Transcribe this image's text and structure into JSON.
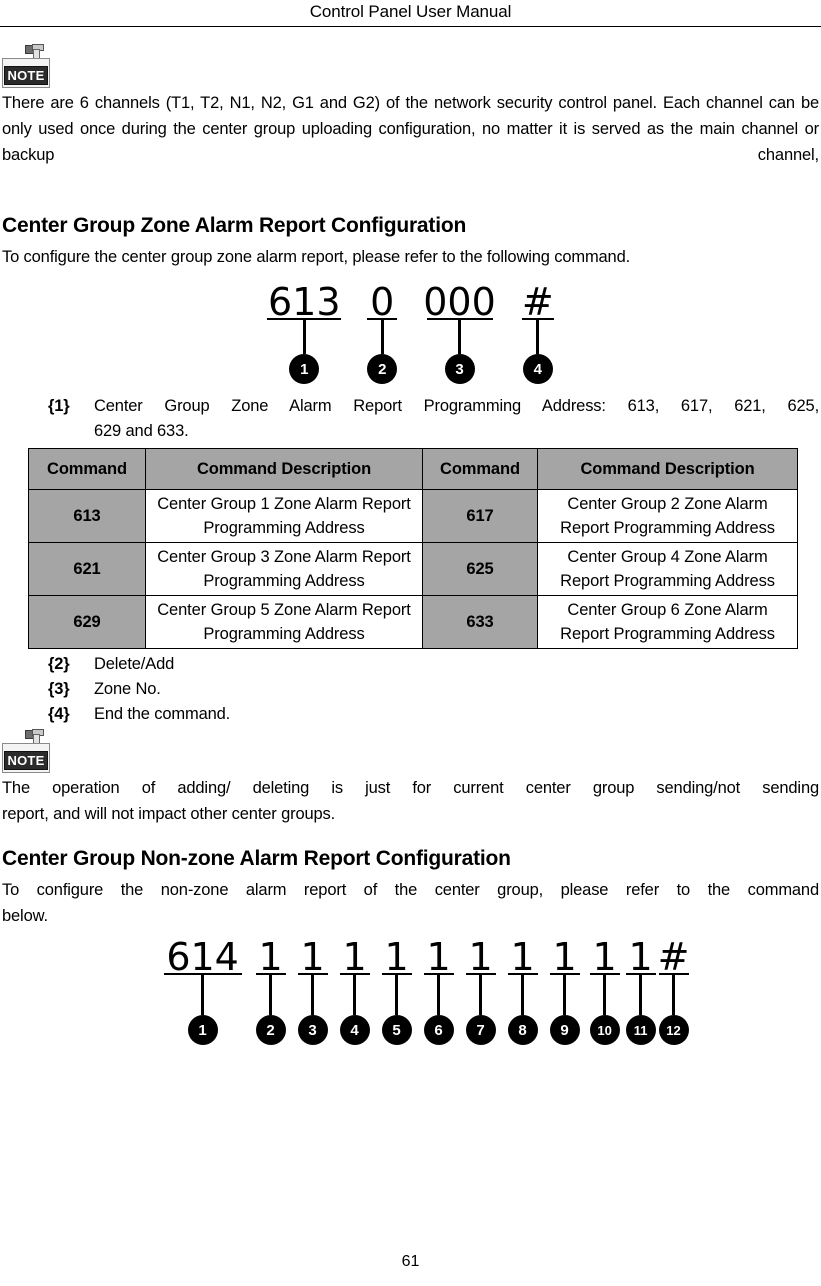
{
  "header": {
    "title": "Control Panel User Manual"
  },
  "note1": {
    "icon_label": "NOTE",
    "text": "There are 6 channels (T1, T2, N1, N2, G1 and G2) of the network security control panel. Each channel can be only used once during the center group uploading configuration, no matter it is served as the main channel or backup channel,",
    "line1": "There are 6 channels (T1, T2, N1, N2, G1 and G2) of the network security control panel.",
    "line2": "Each channel can be only used once during the center group uploading configuration, no",
    "line3": "matter it is served as the main channel or backup channel,"
  },
  "section1": {
    "heading": "Center Group Zone Alarm Report Configuration",
    "intro": "To configure the center group zone alarm report, please refer to the following command.",
    "diagram": {
      "tokens": [
        {
          "glyph": "613",
          "badge": "1"
        },
        {
          "glyph": "0",
          "badge": "2"
        },
        {
          "glyph": "000",
          "badge": "3"
        },
        {
          "glyph": "#",
          "badge": "4"
        }
      ]
    },
    "items": [
      {
        "marker": "{1}",
        "line1": "Center Group Zone Alarm Report Programming Address:   613, 617, 621, 625,",
        "line2": "629 and 633."
      },
      {
        "marker": "{2}",
        "line1": "Delete/Add",
        "line2": ""
      },
      {
        "marker": "{3}",
        "line1": "Zone No.",
        "line2": ""
      },
      {
        "marker": "{4}",
        "line1": "End the command.",
        "line2": ""
      }
    ],
    "table": {
      "headers": [
        "Command",
        "Command Description",
        "Command",
        "Command Description"
      ],
      "rows": [
        {
          "cmd_a": "613",
          "desc_a": "Center Group 1 Zone Alarm Report Programming Address",
          "cmd_b": "617",
          "desc_b": "Center Group 2 Zone Alarm Report Programming Address"
        },
        {
          "cmd_a": "621",
          "desc_a": "Center Group 3 Zone Alarm Report Programming Address",
          "cmd_b": "625",
          "desc_b": "Center Group 4 Zone Alarm Report Programming Address"
        },
        {
          "cmd_a": "629",
          "desc_a": "Center Group 5 Zone Alarm Report Programming Address",
          "cmd_b": "633",
          "desc_b": "Center Group 6 Zone Alarm Report Programming Address"
        }
      ]
    }
  },
  "note2": {
    "icon_label": "NOTE",
    "line1": "The operation of adding/ deleting is just for current center group sending/not sending",
    "line2": "report, and will not impact other center groups."
  },
  "section2": {
    "heading": "Center Group Non-zone Alarm Report Configuration",
    "line1": "To configure the non-zone alarm report of the center group, please refer to the command",
    "line2": "below.",
    "diagram": {
      "tokens": [
        {
          "glyph": "614",
          "badge": "1"
        },
        {
          "glyph": "1",
          "badge": "2"
        },
        {
          "glyph": "1",
          "badge": "3"
        },
        {
          "glyph": "1",
          "badge": "4"
        },
        {
          "glyph": "1",
          "badge": "5"
        },
        {
          "glyph": "1",
          "badge": "6"
        },
        {
          "glyph": "1",
          "badge": "7"
        },
        {
          "glyph": "1",
          "badge": "8"
        },
        {
          "glyph": "1",
          "badge": "9"
        },
        {
          "glyph": "1",
          "badge": "10"
        },
        {
          "glyph": "1",
          "badge": "11"
        },
        {
          "glyph": "#",
          "badge": "12"
        }
      ]
    }
  },
  "footer": {
    "page_number": "61"
  },
  "colors": {
    "table_gray": "#a5a5a5",
    "text": "#000000",
    "badge": "#000000"
  }
}
